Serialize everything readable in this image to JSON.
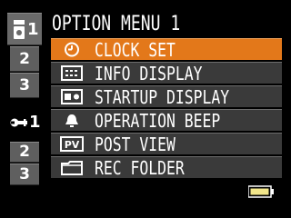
{
  "title": "OPTION MENU 1",
  "tabs": {
    "record": {
      "icon": "camera-icon",
      "items": [
        "1",
        "2",
        "3"
      ]
    },
    "setup": {
      "icon": "wrench-icon",
      "items": [
        "1",
        "2",
        "3"
      ]
    }
  },
  "menu": {
    "items": [
      {
        "label": "CLOCK SET",
        "icon": "clock-icon",
        "selected": true
      },
      {
        "label": "INFO DISPLAY",
        "icon": "info-display-icon",
        "selected": false
      },
      {
        "label": "STARTUP DISPLAY",
        "icon": "startup-display-icon",
        "selected": false
      },
      {
        "label": "OPERATION BEEP",
        "icon": "bell-icon",
        "selected": false
      },
      {
        "label": "POST VIEW",
        "icon": "pv-icon",
        "icon_text": "PV",
        "selected": false
      },
      {
        "label": "REC FOLDER",
        "icon": "folder-icon",
        "selected": false
      }
    ]
  },
  "battery": {
    "icon": "battery-icon",
    "level": 1.0
  },
  "colors": {
    "selected": "#e3781a",
    "item_bg": "#3a3a3a",
    "tab_bg": "#5f5f5f",
    "battery_fill": "#f2e68a"
  }
}
